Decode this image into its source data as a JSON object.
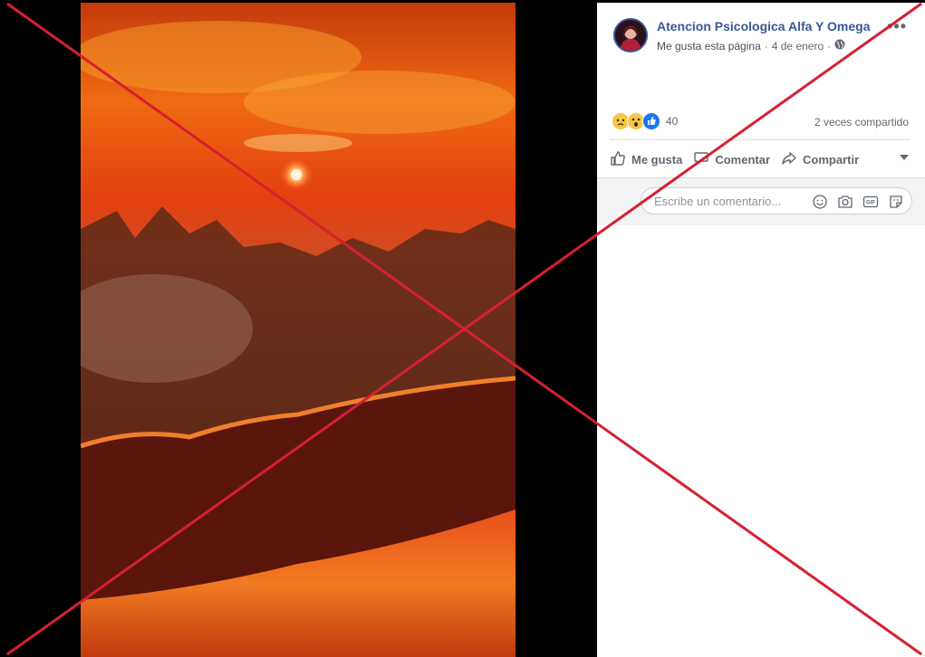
{
  "post": {
    "page_name": "Atencion Psicologica Alfa Y Omega",
    "like_page_link": "Me gusta esta página",
    "separator": "·",
    "date": "4 de enero",
    "privacy_icon": "globe-icon",
    "more_icon": "more-options-icon",
    "more_text": "•••"
  },
  "reactions": {
    "icons": [
      "sad-reaction-icon",
      "wow-reaction-icon",
      "like-reaction-icon"
    ],
    "count": "40",
    "shares": "2 veces compartido"
  },
  "actions": {
    "like": "Me gusta",
    "comment": "Comentar",
    "share": "Compartir"
  },
  "comment": {
    "placeholder": "Escribe un comentario...",
    "icons": [
      "emoji-icon",
      "camera-icon",
      "gif-icon",
      "sticker-icon"
    ]
  },
  "colors": {
    "link_blue": "#385898",
    "like_blue": "#1877f2",
    "reaction_yellow": "#f7c744",
    "cross_red": "#d6202e"
  }
}
